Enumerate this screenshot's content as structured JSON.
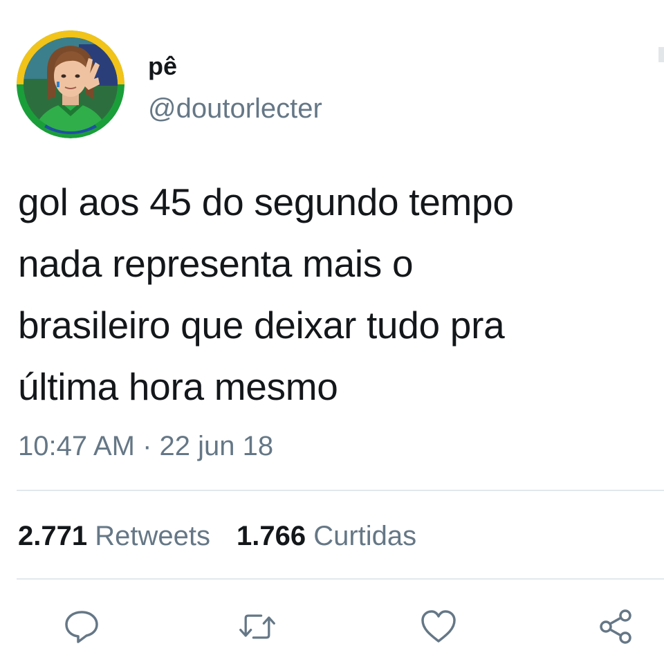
{
  "user": {
    "display_name": "pê",
    "handle": "@doutorlecter",
    "avatar": "profile-avatar"
  },
  "tweet": {
    "lines": [
      "gol aos 45 do segundo tempo",
      "nada representa mais o",
      "brasileiro que deixar tudo pra",
      "última hora mesmo"
    ],
    "timestamp": "10:47 AM · 22 jun 18"
  },
  "stats": {
    "retweets_count": "2.771",
    "retweets_label": "Retweets",
    "likes_count": "1.766",
    "likes_label": "Curtidas"
  },
  "actions": {
    "reply_icon": "reply-icon",
    "retweet_icon": "retweet-icon",
    "like_icon": "heart-icon",
    "share_icon": "share-icon"
  },
  "colors": {
    "text": "#14171a",
    "secondary": "#657786",
    "divider": "#e1e8ed",
    "icon": "#657786"
  }
}
